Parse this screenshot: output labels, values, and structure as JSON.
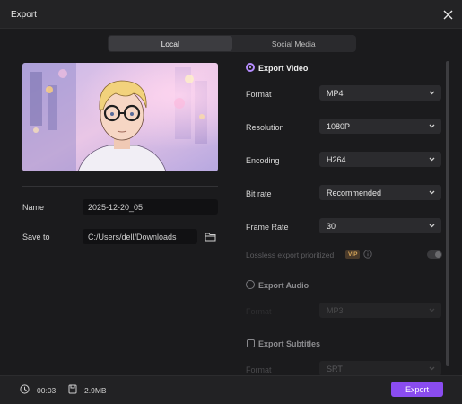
{
  "window": {
    "title": "Export"
  },
  "tabs": [
    {
      "label": "Local",
      "active": true
    },
    {
      "label": "Social Media",
      "active": false
    }
  ],
  "left": {
    "name_label": "Name",
    "name_value": "2025-12-20_05",
    "save_label": "Save to",
    "save_path": "C:/Users/dell/Downloads"
  },
  "video": {
    "title": "Export Video",
    "selected": true,
    "format_label": "Format",
    "format_value": "MP4",
    "resolution_label": "Resolution",
    "resolution_value": "1080P",
    "encoding_label": "Encoding",
    "encoding_value": "H264",
    "bitrate_label": "Bit rate",
    "bitrate_value": "Recommended",
    "framerate_label": "Frame Rate",
    "framerate_value": "30",
    "lossless_label": "Lossless export prioritized",
    "vip_badge": "VIP",
    "lossless_enabled": false
  },
  "audio": {
    "title": "Export Audio",
    "selected": false,
    "format_label": "Format",
    "format_value": "MP3"
  },
  "subtitles": {
    "title": "Export Subtitles",
    "checked": false,
    "format_label": "Format",
    "format_value": "SRT"
  },
  "footer": {
    "duration": "00:03",
    "size": "2.9MB",
    "export_label": "Export"
  },
  "colors": {
    "accent": "#8a4cf0",
    "background": "#1b1b1d",
    "dropdown": "#2b2b2e",
    "field": "#111113"
  },
  "icons": [
    "close-icon",
    "folder-icon",
    "clock-icon",
    "file-size-icon",
    "chevron-down-icon",
    "info-icon"
  ]
}
